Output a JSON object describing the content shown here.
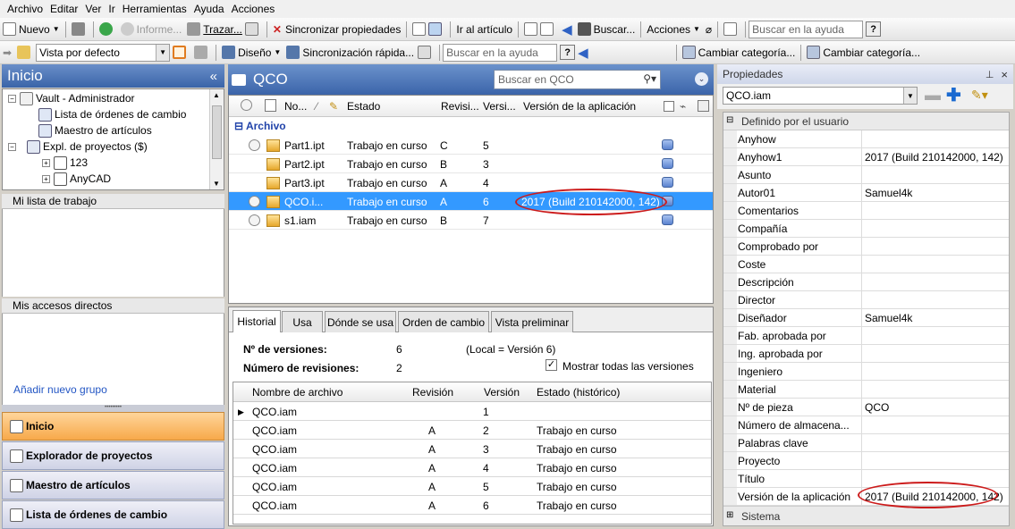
{
  "menu": [
    "Archivo",
    "Editar",
    "Ver",
    "Ir",
    "Herramientas",
    "Ayuda",
    "Acciones"
  ],
  "toolbar1": {
    "nuevo": "Nuevo",
    "informe": "Informe...",
    "trazar": "Trazar...",
    "sincronizar": "Sincronizar propiedades",
    "ir_articulo": "Ir al artículo",
    "buscar": "Buscar...",
    "acciones": "Acciones",
    "help_placeholder": "Buscar en la ayuda",
    "help_q": "?"
  },
  "toolbar2": {
    "view_select": "Vista por defecto",
    "diseno": "Diseño",
    "sincronizacion": "Sincronización rápida...",
    "help_placeholder": "Buscar en la ayuda",
    "help_q": "?",
    "cambiar1": "Cambiar categoría...",
    "cambiar2": "Cambiar categoría..."
  },
  "left": {
    "title": "Inicio",
    "collapse": "«",
    "tree": [
      {
        "label": "Vault - Administrador",
        "exp": "−",
        "indent": 6
      },
      {
        "label": "Lista de órdenes de cambio",
        "exp": "",
        "indent": 40
      },
      {
        "label": "Maestro de artículos",
        "exp": "",
        "indent": 40
      },
      {
        "label": "Expl. de proyectos ($)",
        "exp": "−",
        "indent": 26
      },
      {
        "label": "123",
        "exp": "+",
        "indent": 44
      },
      {
        "label": "AnyCAD",
        "exp": "+",
        "indent": 44
      }
    ],
    "worklist": "Mi lista de trabajo",
    "shortcuts": "Mis accesos directos",
    "add_group": "Añadir nuevo grupo",
    "nav": [
      "Inicio",
      "Explorador de proyectos",
      "Maestro de artículos",
      "Lista de órdenes de cambio"
    ]
  },
  "center": {
    "title": "QCO",
    "search_placeholder": "Buscar en QCO",
    "columns": [
      "No...",
      "Estado",
      "Revisi...",
      "Versi...",
      "Versión de la aplicación"
    ],
    "group": "Archivo",
    "rows": [
      {
        "name": "Part1.ipt",
        "estado": "Trabajo en curso",
        "rev": "C",
        "ver": "5",
        "app": ""
      },
      {
        "name": "Part2.ipt",
        "estado": "Trabajo en curso",
        "rev": "B",
        "ver": "3",
        "app": ""
      },
      {
        "name": "Part3.ipt",
        "estado": "Trabajo en curso",
        "rev": "A",
        "ver": "4",
        "app": ""
      },
      {
        "name": "QCO.i...",
        "estado": "Trabajo en curso",
        "rev": "A",
        "ver": "6",
        "app": "2017 (Build 210142000, 142)"
      },
      {
        "name": "s1.iam",
        "estado": "Trabajo en curso",
        "rev": "B",
        "ver": "7",
        "app": ""
      }
    ]
  },
  "history": {
    "tabs": [
      "Historial",
      "Usa",
      "Dónde se usa",
      "Orden de cambio",
      "Vista preliminar"
    ],
    "n_versions_label": "Nº de versiones:",
    "n_versions": "6",
    "local": "(Local = Versión 6)",
    "n_revisions_label": "Número de revisiones:",
    "n_revisions": "2",
    "show_all": "Mostrar todas las versiones",
    "columns": [
      "Nombre de archivo",
      "Revisión",
      "Versión",
      "Estado (histórico)"
    ],
    "rows": [
      {
        "name": "QCO.iam",
        "rev": "",
        "ver": "1",
        "estado": ""
      },
      {
        "name": "QCO.iam",
        "rev": "A",
        "ver": "2",
        "estado": "Trabajo en curso"
      },
      {
        "name": "QCO.iam",
        "rev": "A",
        "ver": "3",
        "estado": "Trabajo en curso"
      },
      {
        "name": "QCO.iam",
        "rev": "A",
        "ver": "4",
        "estado": "Trabajo en curso"
      },
      {
        "name": "QCO.iam",
        "rev": "A",
        "ver": "5",
        "estado": "Trabajo en curso"
      },
      {
        "name": "QCO.iam",
        "rev": "A",
        "ver": "6",
        "estado": "Trabajo en curso"
      }
    ]
  },
  "props": {
    "title": "Propiedades",
    "pin": "ᵖ",
    "close": "×",
    "selected": "QCO.iam",
    "group": "Definido por el usuario",
    "rows": [
      {
        "k": "Anyhow",
        "v": ""
      },
      {
        "k": "Anyhow1",
        "v": "2017 (Build 210142000, 142)"
      },
      {
        "k": "Asunto",
        "v": ""
      },
      {
        "k": "Autor01",
        "v": "Samuel4k"
      },
      {
        "k": "Comentarios",
        "v": ""
      },
      {
        "k": "Compañía",
        "v": ""
      },
      {
        "k": "Comprobado por",
        "v": ""
      },
      {
        "k": "Coste",
        "v": ""
      },
      {
        "k": "Descripción",
        "v": ""
      },
      {
        "k": "Director",
        "v": ""
      },
      {
        "k": "Diseñador",
        "v": "Samuel4k"
      },
      {
        "k": "Fab. aprobada por",
        "v": ""
      },
      {
        "k": "Ing. aprobada por",
        "v": ""
      },
      {
        "k": "Ingeniero",
        "v": ""
      },
      {
        "k": "Material",
        "v": ""
      },
      {
        "k": "Nº de pieza",
        "v": "QCO"
      },
      {
        "k": "Número de almacena...",
        "v": ""
      },
      {
        "k": "Palabras clave",
        "v": ""
      },
      {
        "k": "Proyecto",
        "v": ""
      },
      {
        "k": "Título",
        "v": ""
      },
      {
        "k": "Versión de la aplicación",
        "v": "2017 (Build 210142000, 142)"
      }
    ],
    "group2": "Sistema"
  }
}
